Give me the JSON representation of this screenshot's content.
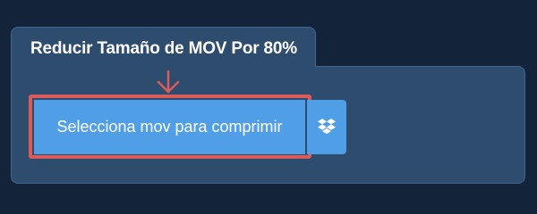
{
  "compressor": {
    "title": "Reducir Tamaño de MOV Por 80%",
    "upload_button_label": "Selecciona mov para comprimir",
    "dropbox_icon": "dropbox-icon",
    "pointer_icon": "down-arrow-icon"
  },
  "colors": {
    "page_background": "#12233a",
    "panel_background": "#2e4c6e",
    "panel_border": "#41668f",
    "button_background": "#4f9ee6",
    "highlight_border": "#d95c5c",
    "text": "#ffffff"
  }
}
